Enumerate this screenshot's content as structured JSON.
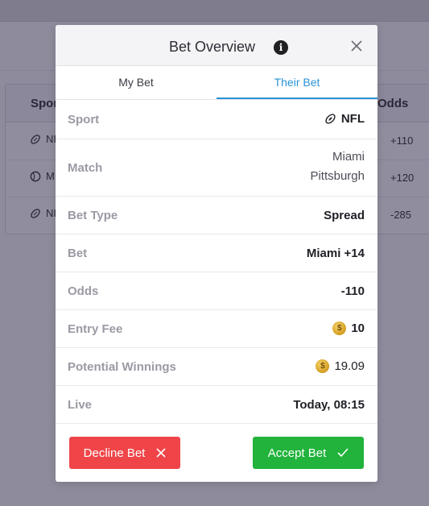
{
  "background": {
    "table": {
      "headers": {
        "sport": "Spor",
        "odds": "Odds"
      },
      "rows": [
        {
          "sport": "NI",
          "icon": "football-icon",
          "odds": "+110"
        },
        {
          "sport": "M",
          "icon": "baseball-icon",
          "odds": "+120"
        },
        {
          "sport": "NI",
          "icon": "football-icon",
          "odds": "-285"
        }
      ]
    }
  },
  "modal": {
    "title": "Bet Overview",
    "tabs": {
      "my_bet": "My Bet",
      "their_bet": "Their Bet",
      "active": "their_bet"
    },
    "details": {
      "sport_label": "Sport",
      "sport_value": "NFL",
      "match_label": "Match",
      "match_team1": "Miami",
      "match_team2": "Pittsburgh",
      "bet_type_label": "Bet Type",
      "bet_type_value": "Spread",
      "bet_label": "Bet",
      "bet_value": "Miami +14",
      "odds_label": "Odds",
      "odds_value": "-110",
      "entry_fee_label": "Entry Fee",
      "entry_fee_value": "10",
      "potential_winnings_label": "Potential Winnings",
      "potential_winnings_value": "19.09",
      "live_label": "Live",
      "live_value": "Today, 08:15"
    },
    "buttons": {
      "decline": "Decline Bet",
      "accept": "Accept Bet"
    },
    "colors": {
      "accent": "#2a93d6",
      "decline": "#ef4549",
      "accept": "#21b33b"
    }
  }
}
